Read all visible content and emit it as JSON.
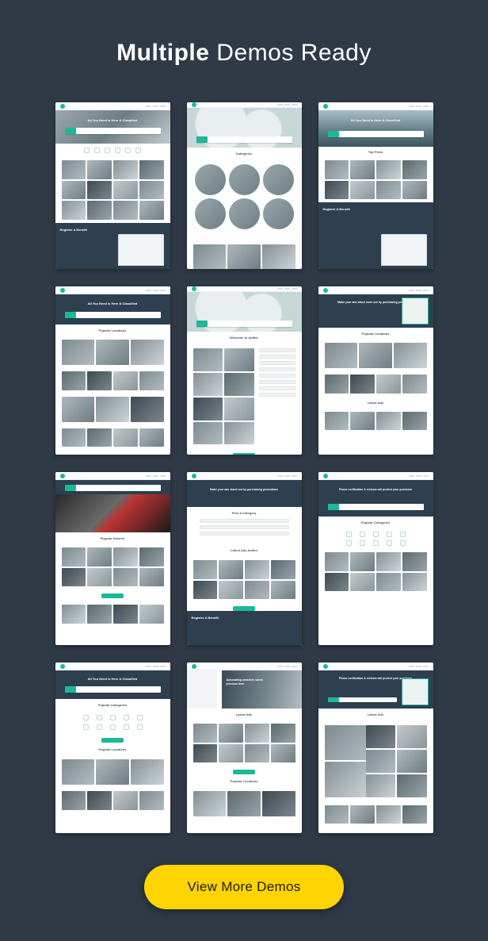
{
  "heading": {
    "bold": "Multiple",
    "rest": " Demos Ready"
  },
  "cta": {
    "label": "View More Demos"
  },
  "demos": [
    {
      "id": 1,
      "hero_text": "All You Need is Here & Classified",
      "register_title": "Register A Benefit"
    },
    {
      "id": 2,
      "section_title": "Categories"
    },
    {
      "id": 3,
      "hero_text": "All You Need is Here & Classified",
      "section_title": "Top Picks",
      "register_title": "Register A Benefit"
    },
    {
      "id": 4,
      "hero_text": "All You Need is Here & Classified",
      "section_title": "Popular Locations"
    },
    {
      "id": 5,
      "section_title": "Welcome to Adifier"
    },
    {
      "id": 6,
      "hero_text": "Make your ads stand more out by purchasing promotions",
      "section_title": "Popular Locations",
      "lower_title": "Latest Ads"
    },
    {
      "id": 7,
      "section_title": "Popular Adverts"
    },
    {
      "id": 8,
      "hero_text": "Make your ads stand out by purchasing promotions",
      "section_title": "Post A Category",
      "lower_title": "Latest Ads Added",
      "footer_title": "Register A Benefit"
    },
    {
      "id": 9,
      "hero_text": "Phone verification & reviews will protect your purchase",
      "section_title": "Popular Categories"
    },
    {
      "id": 10,
      "hero_text": "All You Need is Here & Classified",
      "section_title": "Popular Categories",
      "lower_title": "Popular Locations"
    },
    {
      "id": 11,
      "hero_text": "Automating searches saves precious time",
      "section_title": "Latest Ads",
      "lower_title": "Popular Locations"
    },
    {
      "id": 12,
      "hero_text": "Phone verification & reviews will protect your purchase",
      "section_title": "Latest Ads"
    }
  ]
}
